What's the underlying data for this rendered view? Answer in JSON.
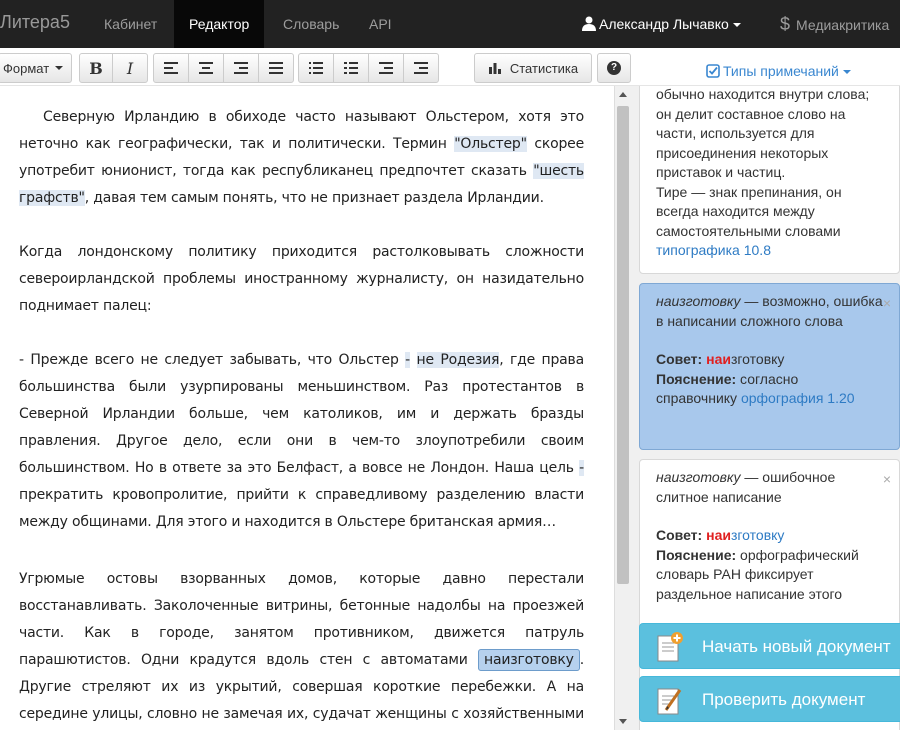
{
  "nav": {
    "brand": "Литера5",
    "items": [
      "Кабинет",
      "Редактор",
      "Словарь",
      "API"
    ],
    "user": "Александр Лычавко",
    "mediacritic": "Медиакритика",
    "dollar": "$"
  },
  "toolbar": {
    "format": "Формат",
    "bold": "B",
    "italic": "I",
    "stats": "Статистика",
    "help": "?"
  },
  "sidebar": {
    "note_types": "Типы примечаний",
    "card1": {
      "lines": [
        "обычно находится внутри слова;",
        "он делит составное слово на",
        "части, используется для",
        "присоединения некоторых",
        "приставок и частиц.",
        "Тире — знак препинания, он",
        "всегда находится между",
        "самостоятельными словами"
      ],
      "link": "типографика 10.8"
    },
    "card2": {
      "word": "наизготовку",
      "text": " — возможно, ошибка в написании сложного слова",
      "advice_label": "Совет:",
      "advice_a": "на",
      "advice_b": "и",
      "advice_c": "зготовку",
      "expl_label": "Пояснение:",
      "expl_text": " согласно справочнику ",
      "expl_link": "орфография 1.20"
    },
    "card3": {
      "word": "наизготовку",
      "text": " — ошибочное слитное написание",
      "advice_label": "Совет:",
      "advice_a": "на",
      "advice_b": "и",
      "advice_c": "зготовку",
      "expl_label": "Пояснение:",
      "expl_text": " орфографический словарь РАН фиксирует раздельное написание этого"
    },
    "btn_new": "Начать новый документ",
    "btn_check": "Проверить документ"
  },
  "editor": {
    "p1a": "Северную Ирландию в обиходе часто называют Ольстером, хотя это неточно как географически, так и политически. Термин ",
    "p1b": "\"Ольстер\"",
    "p1c": " скорее употребит юнионист, тогда как республиканец предпочтет сказать ",
    "p1d": "\"шесть графств\"",
    "p1e": ", давая тем самым понять, что не признает раздела Ирландии.",
    "p2": "Когда лондонскому политику приходится растолковывать сложности североирландской проблемы иностранному журналисту, он назидательно поднимает палец:",
    "p3a": "- Прежде всего не следует забывать, что Ольстер ",
    "p3b": "-",
    "p3c": " ",
    "p3d": "не Родезия",
    "p3e": ", где права большинства были узурпированы меньшинством. Раз протестантов в Северной Ирландии больше, чем католиков, им и держать бразды правления. Другое дело, если они в чем-то злоупотребили своим большинством. Но в ответе за это Белфаст, а вовсе не Лондон. Наша цель ",
    "p3f": "-",
    "p3g": " прекратить кровопролитие, прийти к справедливому разделению власти между общинами. Для этого и находится в Ольстере британская армия…",
    "p4a": "Угрюмые остовы взорванных домов, которые давно перестали восстанавливать. Заколоченные витрины, бетонные надолбы на проезжей части. Как в городе, занятом противником, движется патруль парашютистов. Одни крадутся вдоль стен с автоматами ",
    "p4b": "наизготовку",
    "p4c": ". Другие стреляют их из укрытий, совершая короткие перебежки. А на середине улицы, словно не замечая их, судачат женщины с хозяйственными сумками, возятся шумные ватаги ребятишек. Таким предстает"
  }
}
